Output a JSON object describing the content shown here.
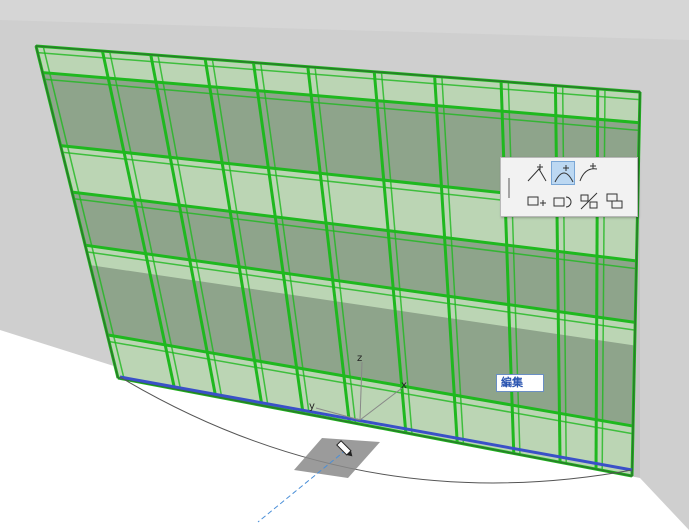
{
  "canvas": {
    "edit_label": "編集",
    "axis_labels": {
      "x": "x",
      "y": "y",
      "z": "z"
    },
    "highlight_edge_color": "#3a50c8",
    "grid_color": "#1fb81f",
    "wall_color": "#cbcbcb"
  },
  "pet_palette": {
    "row1": [
      {
        "name": "offset-edge-icon",
        "active": false
      },
      {
        "name": "curved-edge-icon",
        "active": true
      },
      {
        "name": "arc-edge-icon",
        "active": false
      }
    ],
    "row2": [
      {
        "name": "separator-icon"
      },
      {
        "name": "move-node-icon"
      },
      {
        "name": "rotate-node-icon"
      },
      {
        "name": "mirror-node-icon"
      },
      {
        "name": "elevate-node-icon"
      }
    ]
  }
}
